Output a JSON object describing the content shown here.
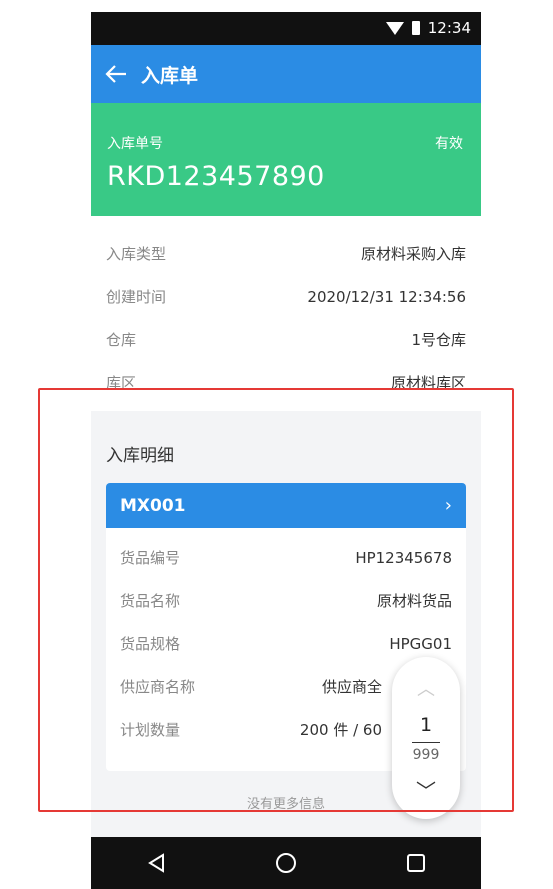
{
  "status_bar": {
    "time": "12:34"
  },
  "app_bar": {
    "title": "入库单"
  },
  "hero": {
    "label": "入库单号",
    "status": "有效",
    "number": "RKD123457890"
  },
  "info_rows": [
    {
      "label": "入库类型",
      "value": "原材料采购入库"
    },
    {
      "label": "创建时间",
      "value": "2020/12/31 12:34:56"
    },
    {
      "label": "仓库",
      "value": "1号仓库"
    },
    {
      "label": "库区",
      "value": "原材料库区"
    }
  ],
  "detail": {
    "title": "入库明细",
    "card_code": "MX001",
    "rows": [
      {
        "label": "货品编号",
        "value": "HP12345678"
      },
      {
        "label": "货品名称",
        "value": "原材料货品"
      },
      {
        "label": "货品规格",
        "value": "HPGG01"
      },
      {
        "label": "供应商名称",
        "value": "供应商全"
      },
      {
        "label": "计划数量",
        "value": "200 件 / 60"
      }
    ],
    "no_more": "没有更多信息"
  },
  "pager": {
    "current": "1",
    "total": "999"
  },
  "colors": {
    "primary": "#2b8ce4",
    "hero": "#39c986",
    "highlight": "#e53935"
  }
}
